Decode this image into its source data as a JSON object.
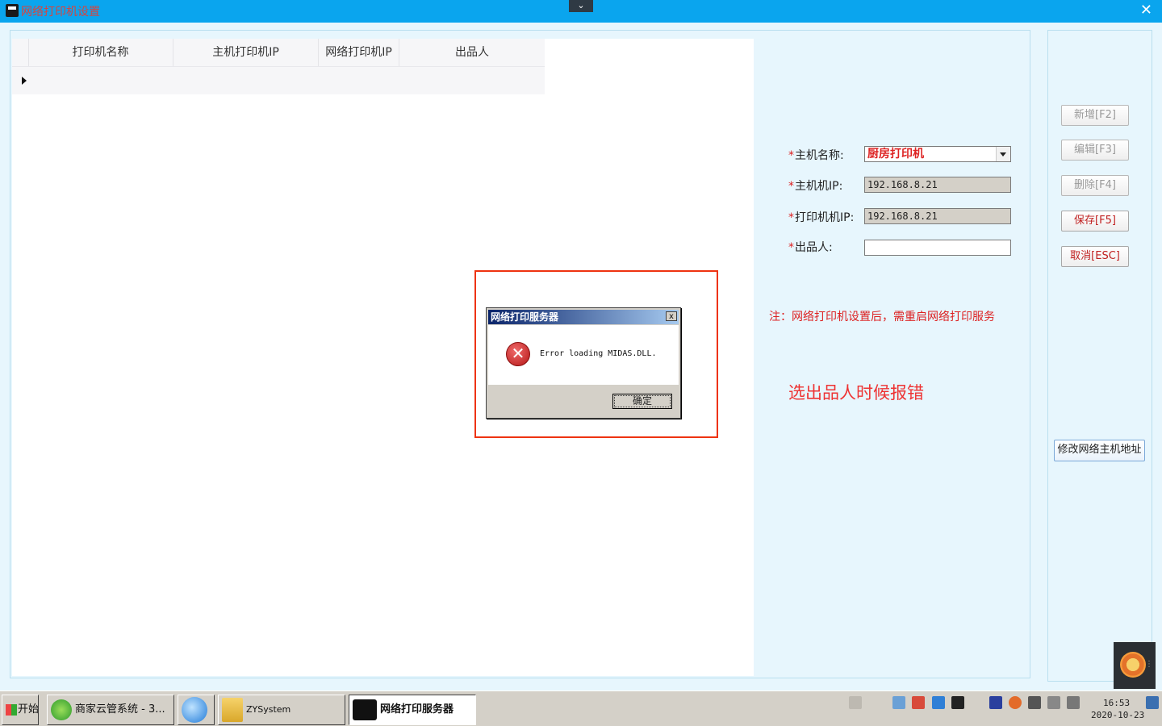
{
  "window": {
    "title": "网络打印机设置",
    "collapse_glyph": "⌄",
    "close_glyph": "✕"
  },
  "grid": {
    "columns": [
      "打印机名称",
      "主机打印机IP",
      "网络打印机IP",
      "出品人"
    ]
  },
  "form": {
    "host_name_label": "主机名称:",
    "host_name_value": "厨房打印机",
    "host_ip_label": "主机机IP:",
    "host_ip_value": "192.168.8.21",
    "printer_ip_label": "打印机机IP:",
    "printer_ip_value": "192.168.8.21",
    "producer_label": "出品人:",
    "producer_value": "",
    "required_mark": "*",
    "note": "注：网络打印机设置后，需重启网络打印服务"
  },
  "annotation": "选出品人时候报错",
  "buttons": {
    "add": "新增[F2]",
    "edit": "编辑[F3]",
    "delete": "删除[F4]",
    "save": "保存[F5]",
    "cancel": "取消[ESC]",
    "modify_host": "修改网络主机地址"
  },
  "dialog": {
    "title": "网络打印服务器",
    "close_glyph": "x",
    "icon_glyph": "✕",
    "message": "Error loading MIDAS.DLL.",
    "ok_label": "确定"
  },
  "taskbar": {
    "start_label": "开始",
    "items": [
      {
        "label": "商家云管系统 - 3..."
      },
      {
        "label": ""
      },
      {
        "label": "ZYSystem"
      },
      {
        "label": "网络打印服务器"
      }
    ],
    "time": "16:53",
    "date": "2020-10-23"
  },
  "colors": {
    "titlebar": "#0aa5ee",
    "background": "#e7f6fd",
    "required": "#dd2222",
    "annotation_red": "#ee3333"
  }
}
